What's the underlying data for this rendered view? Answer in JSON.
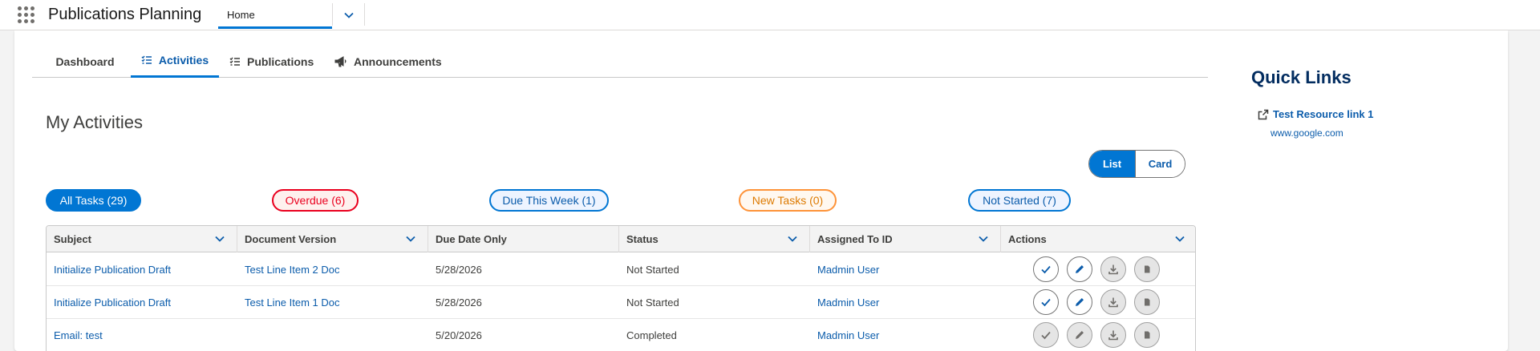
{
  "header": {
    "app_title": "Publications Planning",
    "nav_tab": "Home",
    "icons": {
      "app_launcher": "waffle-icon",
      "nav_menu": "chevron-down-icon"
    }
  },
  "subtabs": [
    {
      "label": "Dashboard",
      "active": false,
      "icon": ""
    },
    {
      "label": "Activities",
      "active": true,
      "icon": "list-icon"
    },
    {
      "label": "Publications",
      "active": false,
      "icon": "list-icon"
    },
    {
      "label": "Announcements",
      "active": false,
      "icon": "megaphone-icon"
    }
  ],
  "section_title": "My Activities",
  "view_toggle": {
    "list": "List",
    "card": "Card",
    "selected": "List"
  },
  "filters": {
    "all": "All Tasks (29)",
    "overdue": "Overdue (6)",
    "due_this_week": "Due This Week (1)",
    "new_tasks": "New Tasks (0)",
    "not_started": "Not Started (7)"
  },
  "table": {
    "columns": [
      "Subject",
      "Document Version",
      "Due Date Only",
      "Status",
      "Assigned To ID",
      "Actions"
    ],
    "rows": [
      {
        "subject": "Initialize Publication Draft",
        "doc_version": "Test Line Item 2 Doc",
        "due": "5/28/2026",
        "status": "Not Started",
        "assigned": "Madmin User",
        "actions_enabled": true
      },
      {
        "subject": "Initialize Publication Draft",
        "doc_version": "Test Line Item 1 Doc",
        "due": "5/28/2026",
        "status": "Not Started",
        "assigned": "Madmin User",
        "actions_enabled": true
      },
      {
        "subject": "Email: test",
        "doc_version": "",
        "due": "5/20/2026",
        "status": "Completed",
        "assigned": "Madmin User",
        "actions_enabled": false
      }
    ],
    "action_icons": [
      "check-icon",
      "pencil-icon",
      "download-icon",
      "document-icon"
    ]
  },
  "quick_links": {
    "title": "Quick Links",
    "items": [
      {
        "label": "Test Resource link 1",
        "url_text": "www.google.com",
        "icon": "external-link-icon"
      }
    ]
  },
  "colors": {
    "brand": "#0176d3",
    "brand_text": "#0b5cab",
    "overdue": "#ea001e",
    "new_tasks": "#dd7a01"
  }
}
